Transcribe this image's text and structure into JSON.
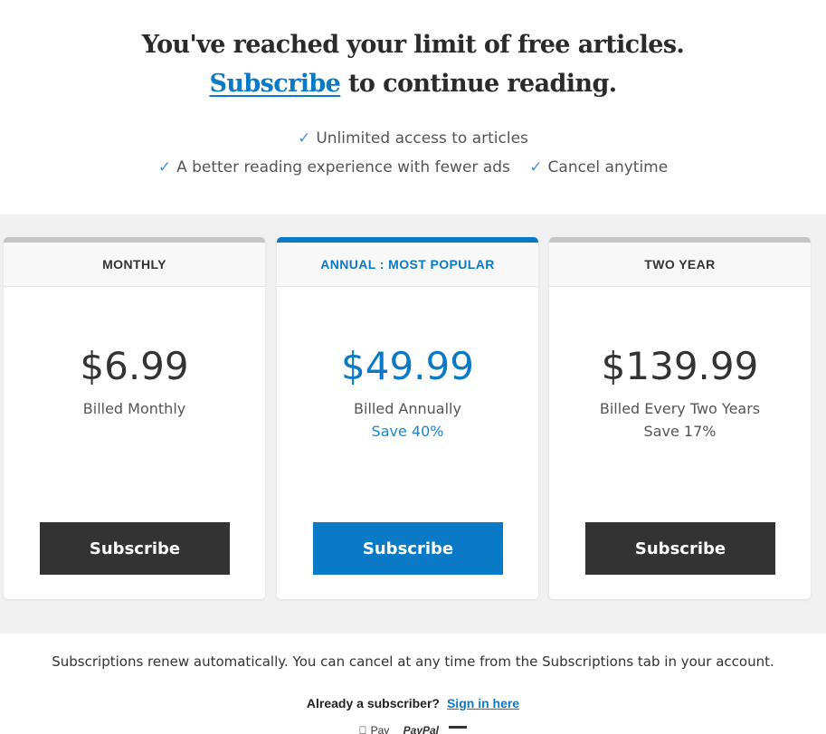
{
  "header": {
    "line1": "You've reached your limit of free articles.",
    "subscribe_link": "Subscribe",
    "line2_rest": " to continue reading."
  },
  "benefits": [
    "Unlimited access to articles",
    "A better reading experience with fewer ads",
    "Cancel anytime"
  ],
  "check_glyph": "✓",
  "plans": [
    {
      "name": "MONTHLY",
      "price": "$6.99",
      "billing": "Billed Monthly",
      "save": "",
      "button": "Subscribe"
    },
    {
      "name": "ANNUAL : MOST POPULAR",
      "price": "$49.99",
      "billing": "Billed Annually",
      "save": "Save 40%",
      "button": "Subscribe"
    },
    {
      "name": "TWO YEAR",
      "price": "$139.99",
      "billing": "Billed Every Two Years",
      "save": "Save 17%",
      "button": "Subscribe"
    }
  ],
  "footer": {
    "renew_note": "Subscriptions renew automatically. You can cancel at any time from the Subscriptions tab in your account.",
    "already_text": "Already a subscriber?",
    "sign_in": "Sign in here",
    "apple_pay": "Pay",
    "paypal": "PayPal"
  },
  "colors": {
    "accent": "#0a79c6",
    "dark_button": "#333333",
    "band": "#f1f1f1"
  },
  "icons": [
    "check-icon",
    "apple-pay-icon",
    "paypal-icon",
    "credit-card-icon"
  ]
}
